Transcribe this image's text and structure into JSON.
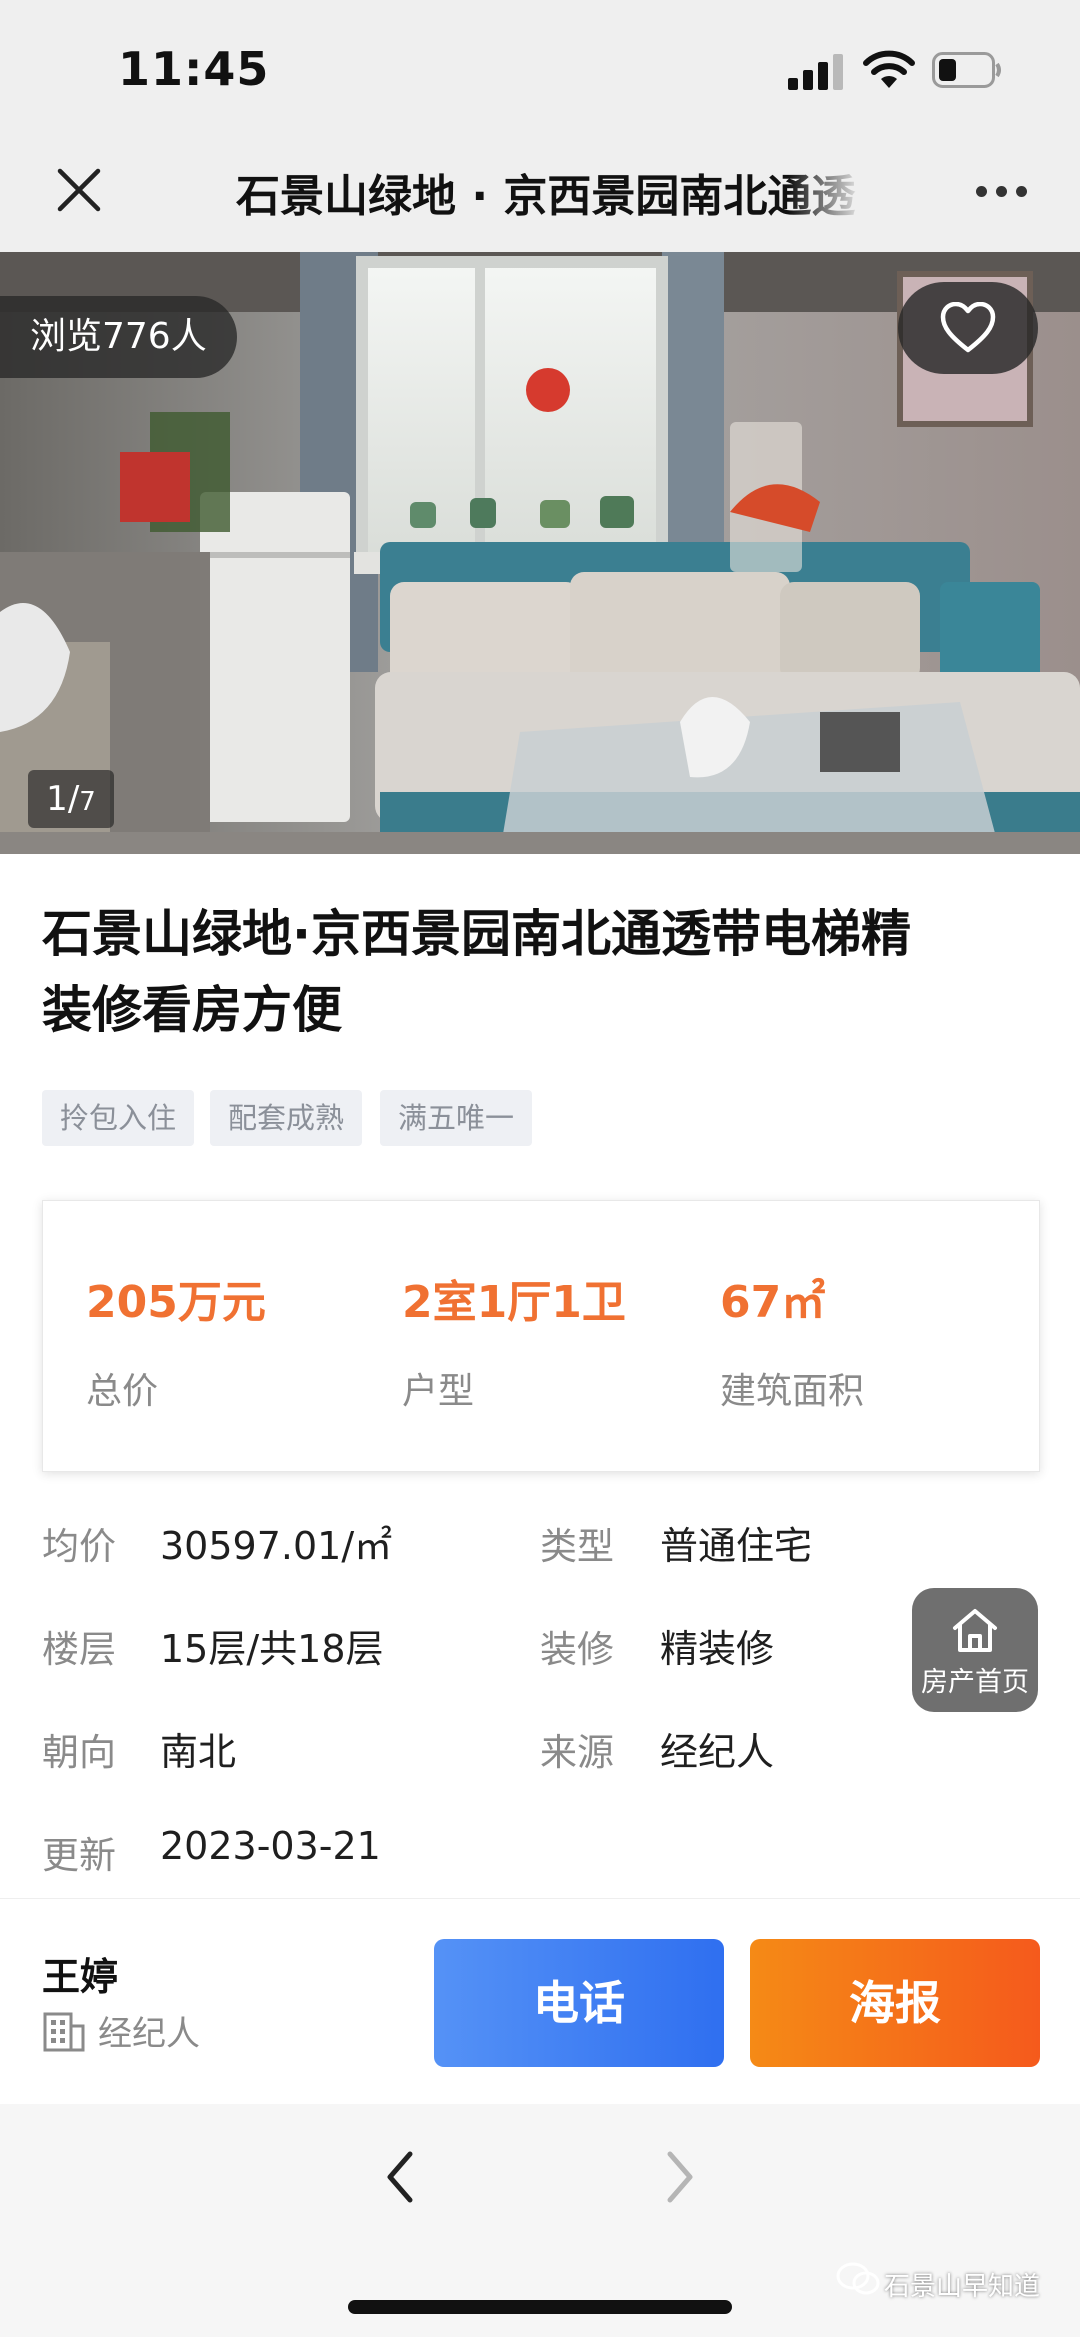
{
  "status_bar": {
    "time": "11:45"
  },
  "nav": {
    "title": "石景山绿地 · 京西景园南北通透"
  },
  "photo": {
    "views_label": "浏览776人",
    "counter_current": "1",
    "counter_total": "7"
  },
  "listing": {
    "title_line1": "石景山绿地·京西景园南北通透带电梯精",
    "title_line2": "装修看房方便",
    "tags": [
      "拎包入住",
      "配套成熟",
      "满五唯一"
    ]
  },
  "key_facts": [
    {
      "value": "205万元",
      "label": "总价"
    },
    {
      "value": "2室1厅1卫",
      "label": "户型"
    },
    {
      "value": "67㎡",
      "label": "建筑面积"
    }
  ],
  "details": {
    "unit_price": {
      "label": "均价",
      "value": "30597.01/㎡"
    },
    "type": {
      "label": "类型",
      "value": "普通住宅"
    },
    "floor": {
      "label": "楼层",
      "value": "15层/共18层"
    },
    "decoration": {
      "label": "装修",
      "value": "精装修"
    },
    "orientation": {
      "label": "朝向",
      "value": "南北"
    },
    "source": {
      "label": "来源",
      "value": "经纪人"
    },
    "updated": {
      "label": "更新",
      "value": "2023-03-21"
    }
  },
  "floating": {
    "home_label": "房产首页"
  },
  "agent": {
    "name": "王婷",
    "role": "经纪人"
  },
  "actions": {
    "call_label": "电话",
    "poster_label": "海报"
  },
  "watermark": "石景山早知道",
  "colors": {
    "accent_orange": "#f07132",
    "call_blue": "#3b7cf2",
    "poster_orange": "#f56d1a"
  }
}
